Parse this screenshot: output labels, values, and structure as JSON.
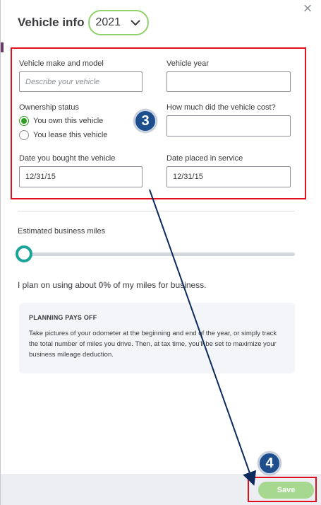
{
  "header": {
    "title": "Vehicle info",
    "year_value": "2021",
    "close_symbol": "×"
  },
  "form": {
    "make_model_label": "Vehicle make and model",
    "make_model_placeholder": "Describe your vehicle",
    "year_label": "Vehicle year",
    "ownership_label": "Ownership status",
    "own_option": "You own this vehicle",
    "lease_option": "You lease this vehicle",
    "cost_label": "How much did the vehicle cost?",
    "bought_date_label": "Date you bought the vehicle",
    "bought_date_value": "12/31/15",
    "service_date_label": "Date placed in service",
    "service_date_value": "12/31/15"
  },
  "miles": {
    "label": "Estimated business miles",
    "slider_fraction": 0,
    "usage_prefix": "I plan on using about",
    "usage_percent": "0%",
    "usage_suffix": "of my miles for business."
  },
  "tip": {
    "title": "PLANNING PAYS OFF",
    "text": "Take pictures of your odometer at the beginning and end of the year, or simply track the total number of miles you drive. Then, at tax time, you'll be set to maximize your business mileage deduction."
  },
  "annotations": {
    "step3": "3",
    "step4": "4"
  },
  "footer": {
    "save_label": "Save"
  },
  "colors": {
    "accent_green": "#2ca01c",
    "slider_teal": "#1ba398",
    "highlight_red": "#e0101e",
    "badge_blue": "#1e4f8c",
    "save_disabled": "#a6d88f"
  }
}
